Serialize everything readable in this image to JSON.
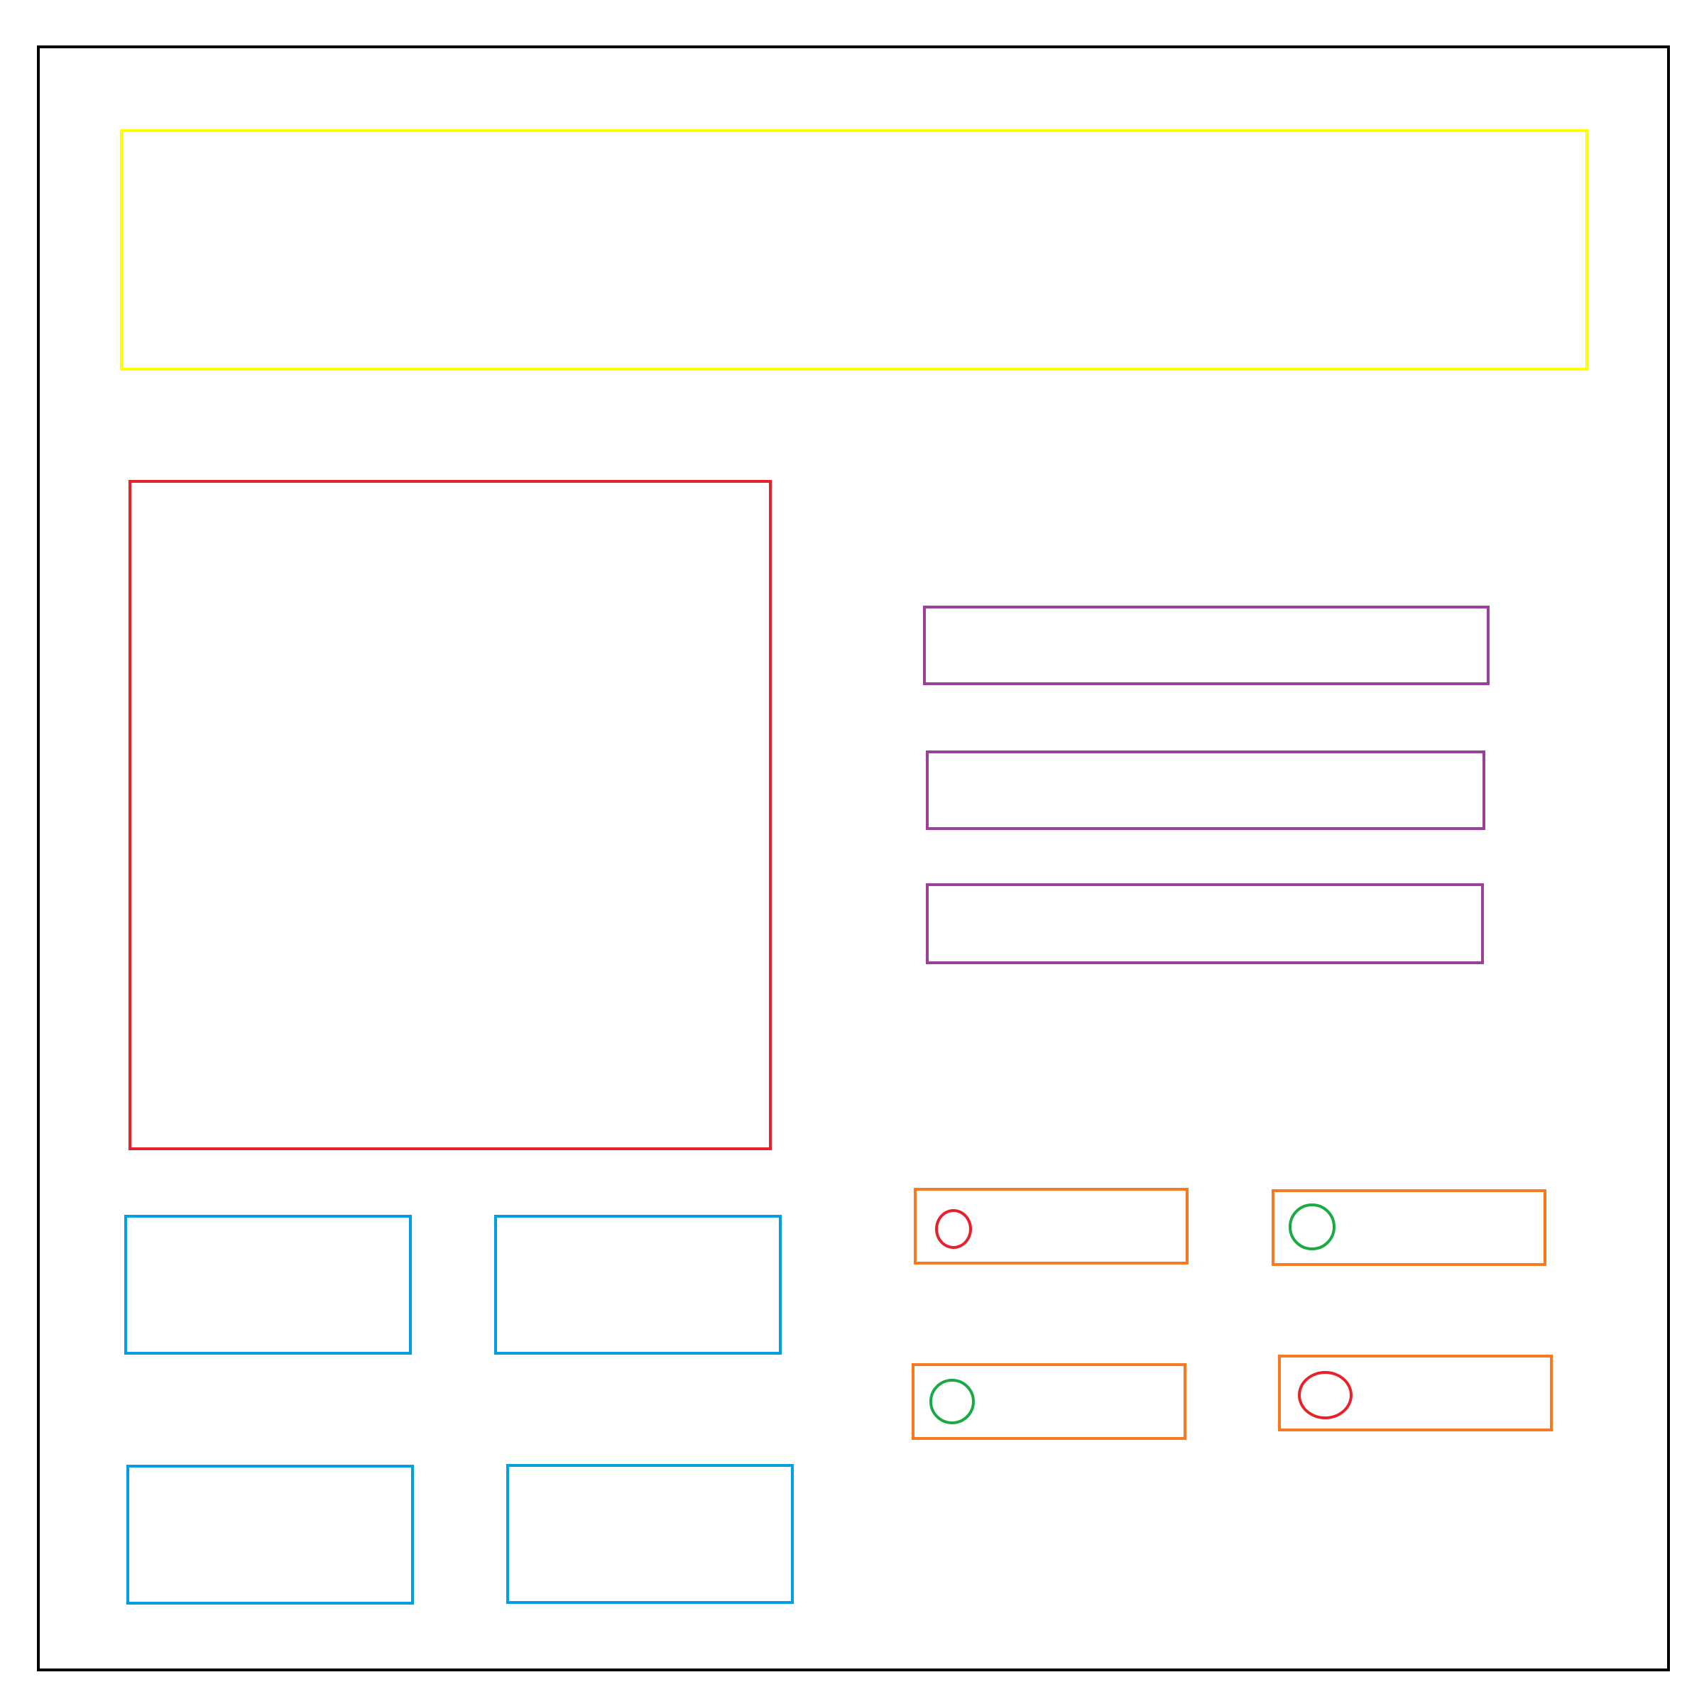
{
  "colors": {
    "frame": "#000000",
    "header": "#ffff00",
    "main_panel": "#e8202a",
    "text_fields": "#9b3f9b",
    "tiles": "#009fe3",
    "option_rows": "#f57a20",
    "status_off": "#e8202a",
    "status_on": "#1aaa44"
  },
  "options": [
    {
      "status": "off"
    },
    {
      "status": "on"
    },
    {
      "status": "on"
    },
    {
      "status": "off"
    }
  ]
}
